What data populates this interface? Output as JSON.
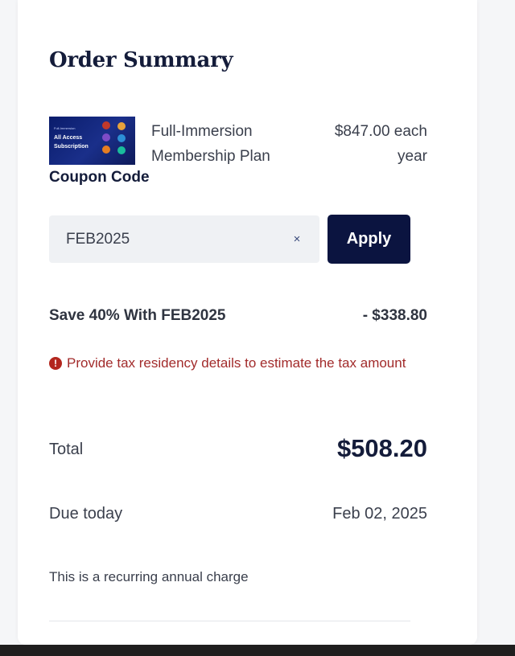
{
  "order_summary": {
    "title": "Order Summary"
  },
  "product": {
    "image": {
      "small_text": "Full-Immersion",
      "line1": "All Access",
      "line2": "Subscription"
    },
    "name": "Full-Immersion Membership Plan",
    "price": "$847.00 each year"
  },
  "coupon": {
    "label": "Coupon Code",
    "value": "FEB2025",
    "clear_icon": "×",
    "apply_label": "Apply"
  },
  "discount": {
    "label": "Save 40% With FEB2025",
    "value": "- $338.80"
  },
  "warning": {
    "icon": "!",
    "text": "Provide tax residency details to estimate the tax amount"
  },
  "total": {
    "label": "Total",
    "value": "$508.20"
  },
  "due": {
    "label": "Due today",
    "value": "Feb 02, 2025"
  },
  "recurring_note": "This is a recurring annual charge",
  "colors": {
    "primary_navy": "#0b1440",
    "title_navy": "#141c3a",
    "warning_red": "#a22b2b",
    "input_bg": "#eff1f4"
  }
}
